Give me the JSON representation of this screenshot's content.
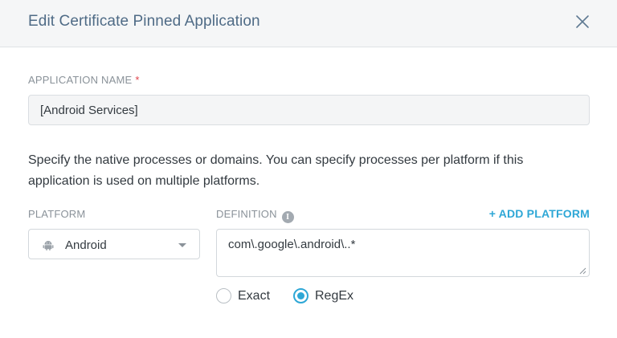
{
  "dialog": {
    "title": "Edit Certificate Pinned Application",
    "close_icon": "close-icon"
  },
  "application_name": {
    "label": "APPLICATION NAME",
    "required_marker": "*",
    "value": "[Android Services]"
  },
  "description": "Specify the native processes or domains. You can specify processes per platform if this application is used on multiple platforms.",
  "platform": {
    "label": "PLATFORM",
    "selected": "Android",
    "icon": "android-icon"
  },
  "definition": {
    "label": "DEFINITION",
    "info_icon_glyph": "i",
    "value": "com\\.google\\.android\\..*"
  },
  "add_platform_label": "+ ADD PLATFORM",
  "match_type": {
    "options": [
      {
        "label": "Exact",
        "checked": false
      },
      {
        "label": "RegEx",
        "checked": true
      }
    ]
  },
  "colors": {
    "accent": "#2ea7d6",
    "title": "#4f6b86",
    "required": "#e0434b"
  }
}
